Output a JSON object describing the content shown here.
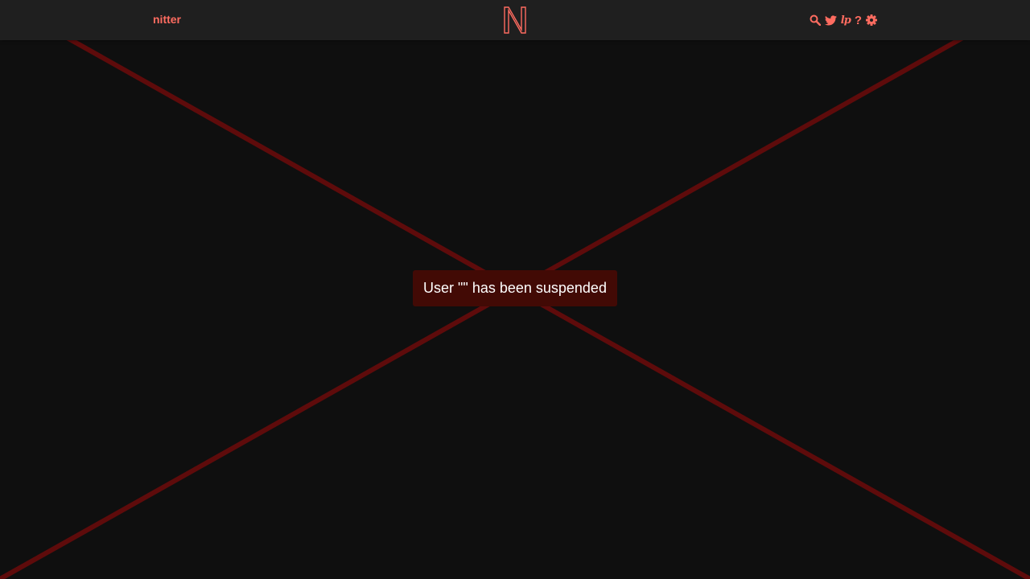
{
  "navbar": {
    "site_name": "nitter",
    "logo_letter": "N",
    "icons": [
      "search-icon",
      "twitter-bird-icon",
      "rss-icon",
      "help-icon",
      "gear-icon"
    ],
    "rss_glyph": "lp",
    "help_glyph": "?"
  },
  "error": {
    "message": "User \"\" has been suspended"
  },
  "colors": {
    "accent": "#ff6c60",
    "navbar_bg": "#1f1f1f",
    "page_bg": "#0f0f0f",
    "error_bg": "#420a05",
    "cross_line": "#8b0000"
  }
}
